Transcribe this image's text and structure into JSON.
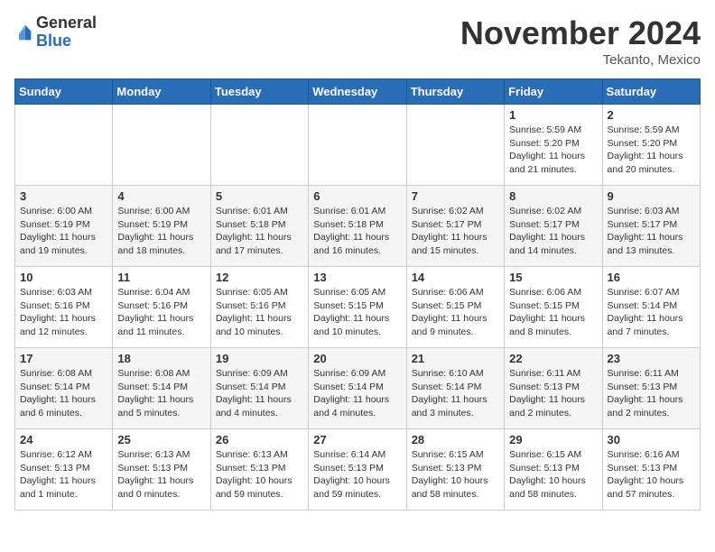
{
  "logo": {
    "general": "General",
    "blue": "Blue"
  },
  "header": {
    "month": "November 2024",
    "location": "Tekanto, Mexico"
  },
  "weekdays": [
    "Sunday",
    "Monday",
    "Tuesday",
    "Wednesday",
    "Thursday",
    "Friday",
    "Saturday"
  ],
  "weeks": [
    [
      {
        "day": "",
        "info": ""
      },
      {
        "day": "",
        "info": ""
      },
      {
        "day": "",
        "info": ""
      },
      {
        "day": "",
        "info": ""
      },
      {
        "day": "",
        "info": ""
      },
      {
        "day": "1",
        "info": "Sunrise: 5:59 AM\nSunset: 5:20 PM\nDaylight: 11 hours\nand 21 minutes."
      },
      {
        "day": "2",
        "info": "Sunrise: 5:59 AM\nSunset: 5:20 PM\nDaylight: 11 hours\nand 20 minutes."
      }
    ],
    [
      {
        "day": "3",
        "info": "Sunrise: 6:00 AM\nSunset: 5:19 PM\nDaylight: 11 hours\nand 19 minutes."
      },
      {
        "day": "4",
        "info": "Sunrise: 6:00 AM\nSunset: 5:19 PM\nDaylight: 11 hours\nand 18 minutes."
      },
      {
        "day": "5",
        "info": "Sunrise: 6:01 AM\nSunset: 5:18 PM\nDaylight: 11 hours\nand 17 minutes."
      },
      {
        "day": "6",
        "info": "Sunrise: 6:01 AM\nSunset: 5:18 PM\nDaylight: 11 hours\nand 16 minutes."
      },
      {
        "day": "7",
        "info": "Sunrise: 6:02 AM\nSunset: 5:17 PM\nDaylight: 11 hours\nand 15 minutes."
      },
      {
        "day": "8",
        "info": "Sunrise: 6:02 AM\nSunset: 5:17 PM\nDaylight: 11 hours\nand 14 minutes."
      },
      {
        "day": "9",
        "info": "Sunrise: 6:03 AM\nSunset: 5:17 PM\nDaylight: 11 hours\nand 13 minutes."
      }
    ],
    [
      {
        "day": "10",
        "info": "Sunrise: 6:03 AM\nSunset: 5:16 PM\nDaylight: 11 hours\nand 12 minutes."
      },
      {
        "day": "11",
        "info": "Sunrise: 6:04 AM\nSunset: 5:16 PM\nDaylight: 11 hours\nand 11 minutes."
      },
      {
        "day": "12",
        "info": "Sunrise: 6:05 AM\nSunset: 5:16 PM\nDaylight: 11 hours\nand 10 minutes."
      },
      {
        "day": "13",
        "info": "Sunrise: 6:05 AM\nSunset: 5:15 PM\nDaylight: 11 hours\nand 10 minutes."
      },
      {
        "day": "14",
        "info": "Sunrise: 6:06 AM\nSunset: 5:15 PM\nDaylight: 11 hours\nand 9 minutes."
      },
      {
        "day": "15",
        "info": "Sunrise: 6:06 AM\nSunset: 5:15 PM\nDaylight: 11 hours\nand 8 minutes."
      },
      {
        "day": "16",
        "info": "Sunrise: 6:07 AM\nSunset: 5:14 PM\nDaylight: 11 hours\nand 7 minutes."
      }
    ],
    [
      {
        "day": "17",
        "info": "Sunrise: 6:08 AM\nSunset: 5:14 PM\nDaylight: 11 hours\nand 6 minutes."
      },
      {
        "day": "18",
        "info": "Sunrise: 6:08 AM\nSunset: 5:14 PM\nDaylight: 11 hours\nand 5 minutes."
      },
      {
        "day": "19",
        "info": "Sunrise: 6:09 AM\nSunset: 5:14 PM\nDaylight: 11 hours\nand 4 minutes."
      },
      {
        "day": "20",
        "info": "Sunrise: 6:09 AM\nSunset: 5:14 PM\nDaylight: 11 hours\nand 4 minutes."
      },
      {
        "day": "21",
        "info": "Sunrise: 6:10 AM\nSunset: 5:14 PM\nDaylight: 11 hours\nand 3 minutes."
      },
      {
        "day": "22",
        "info": "Sunrise: 6:11 AM\nSunset: 5:13 PM\nDaylight: 11 hours\nand 2 minutes."
      },
      {
        "day": "23",
        "info": "Sunrise: 6:11 AM\nSunset: 5:13 PM\nDaylight: 11 hours\nand 2 minutes."
      }
    ],
    [
      {
        "day": "24",
        "info": "Sunrise: 6:12 AM\nSunset: 5:13 PM\nDaylight: 11 hours\nand 1 minute."
      },
      {
        "day": "25",
        "info": "Sunrise: 6:13 AM\nSunset: 5:13 PM\nDaylight: 11 hours\nand 0 minutes."
      },
      {
        "day": "26",
        "info": "Sunrise: 6:13 AM\nSunset: 5:13 PM\nDaylight: 10 hours\nand 59 minutes."
      },
      {
        "day": "27",
        "info": "Sunrise: 6:14 AM\nSunset: 5:13 PM\nDaylight: 10 hours\nand 59 minutes."
      },
      {
        "day": "28",
        "info": "Sunrise: 6:15 AM\nSunset: 5:13 PM\nDaylight: 10 hours\nand 58 minutes."
      },
      {
        "day": "29",
        "info": "Sunrise: 6:15 AM\nSunset: 5:13 PM\nDaylight: 10 hours\nand 58 minutes."
      },
      {
        "day": "30",
        "info": "Sunrise: 6:16 AM\nSunset: 5:13 PM\nDaylight: 10 hours\nand 57 minutes."
      }
    ]
  ]
}
